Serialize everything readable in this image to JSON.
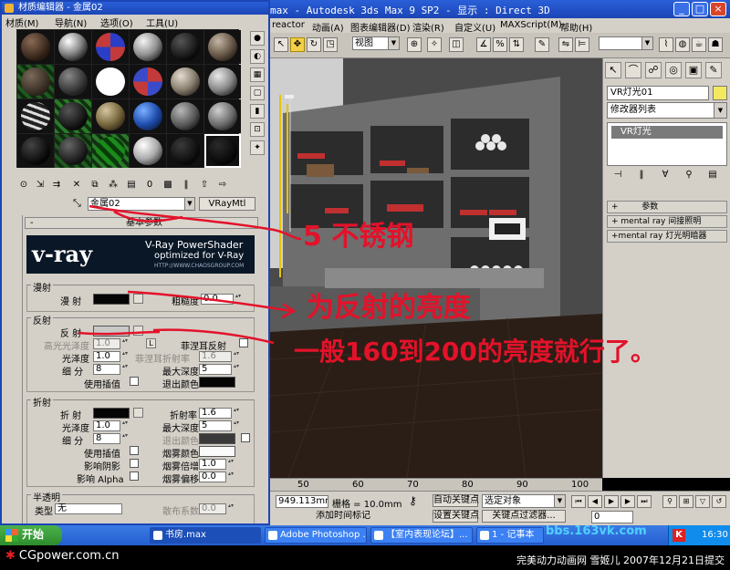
{
  "max_window": {
    "title": "max - Autodesk 3ds Max 9 SP2 - 显示 : Direct 3D",
    "menus": [
      "reactor",
      "动画(A)",
      "图表编辑器(D)",
      "渲染(R)",
      "自定义(U)",
      "MAXScript(M)",
      "帮助(H)"
    ],
    "toolbar": {
      "view_combo": "视图"
    },
    "command_panel": {
      "object_name": "VR灯光01",
      "modifier_list": "修改器列表",
      "stack_item": "VR灯光",
      "rollouts": [
        "参数",
        "mental ray 间接照明",
        "mental ray 灯光明暗器"
      ]
    },
    "timeline": {
      "ticks": [
        "50",
        "60",
        "70",
        "80",
        "90",
        "100"
      ]
    },
    "status": {
      "coord": "949.113mm",
      "grid": "栅格 = 10.0mm",
      "auto_key": "自动关键点",
      "set_key": "设置关键点",
      "selection_combo": "选定对象",
      "key_filters": "关键点过滤器...",
      "add_time_tag": "添加时间标记",
      "frame": "0"
    }
  },
  "material_editor": {
    "title": "材质编辑器 - 金属02",
    "menus": [
      "材质(M)",
      "导航(N)",
      "选项(O)",
      "工具(U)"
    ],
    "material_name": "金属02",
    "material_type": "VRayMtl",
    "params_header": "基本参数",
    "vray_banner": {
      "logo": "v-ray",
      "line1": "V-Ray PowerShader",
      "line2": "optimized for V-Ray",
      "line3": "HTTP://WWW.CHAOSGROUP.COM"
    },
    "diffuse": {
      "group": "漫射",
      "label": "漫 射",
      "roughness_label": "粗糙度",
      "roughness": "0.0"
    },
    "reflection": {
      "group": "反射",
      "label": "反 射",
      "hilight_gloss_label": "高光光泽度",
      "hilight_gloss": "1.0",
      "l_button": "L",
      "fresnel_label": "菲涅耳反射",
      "fresnel_ior_label": "菲涅耳折射率",
      "fresnel_ior": "1.6",
      "gloss_label": "光泽度",
      "gloss": "1.0",
      "subdivs_label": "细  分",
      "subdivs": "8",
      "max_depth_label": "最大深度",
      "max_depth": "5",
      "interp_label": "使用插值",
      "exit_color_label": "退出颜色"
    },
    "refraction": {
      "group": "折射",
      "label": "折 射",
      "ior_label": "折射率",
      "ior": "1.6",
      "gloss_label": "光泽度",
      "gloss": "1.0",
      "max_depth_label": "最大深度",
      "max_depth": "5",
      "subdivs_label": "细  分",
      "subdivs": "8",
      "exit_color_label": "退出颜色",
      "interp_label": "使用插值",
      "fog_color_label": "烟雾颜色",
      "shadows_label": "影响阴影",
      "fog_mult_label": "烟雾倍增",
      "fog_mult": "1.0",
      "alpha_label": "影响 Alpha",
      "fog_bias_label": "烟雾偏移",
      "fog_bias": "0.0"
    },
    "translucency": {
      "group": "半透明",
      "type_label": "类型",
      "type": "无",
      "scatter_label": "散布系数",
      "scatter": "0.0"
    }
  },
  "annotations": {
    "a1": "5 不锈钢",
    "a2": "为反射的亮度",
    "a3": "一般160到200的亮度就行了。"
  },
  "taskbar": {
    "start": "开始",
    "tasks": [
      "书房.max",
      "Adobe Photoshop ...",
      "【室内表现论坛】...",
      "1 - 记事本"
    ],
    "time": "16:30"
  },
  "watermark": "bbs.163vk.com",
  "footer": {
    "logo": "CGpower.com.cn",
    "credit": "完美动力动画网 雪姬儿 2007年12月21日提交"
  }
}
